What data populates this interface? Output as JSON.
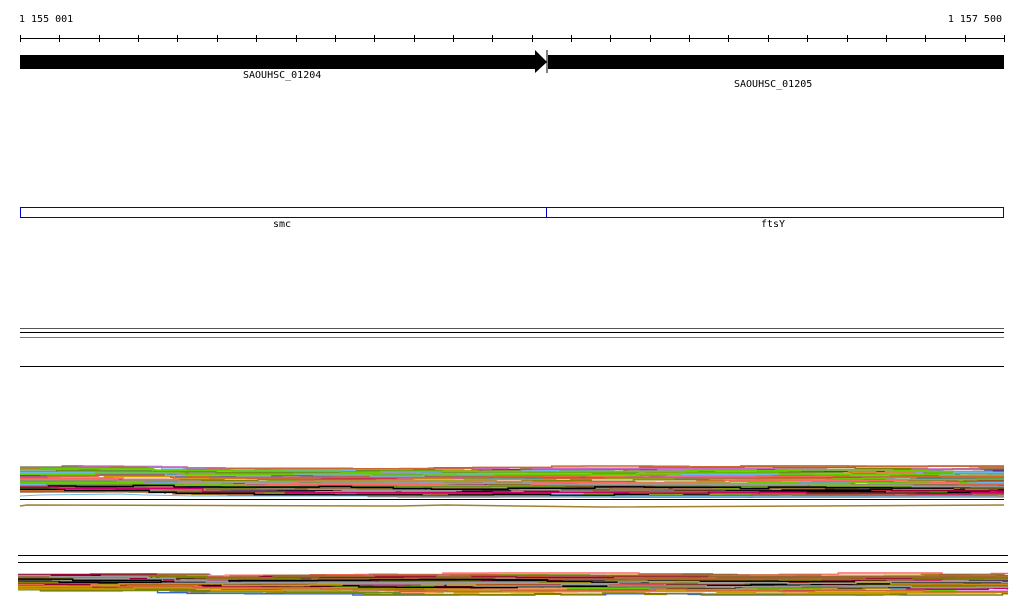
{
  "ruler": {
    "start_label": "1 155 001",
    "end_label": "1 157 500",
    "tick_count": 25
  },
  "genes": [
    {
      "name": "SAOUHSC_01204",
      "strand": "+"
    },
    {
      "name": "SAOUHSC_01205",
      "strand": "+"
    }
  ],
  "features": [
    {
      "name": "smc"
    },
    {
      "name": "ftsY"
    }
  ],
  "colors": {
    "feature_outline": "#0000cc",
    "green_line": "#00cc00",
    "track_palette": [
      "#808000",
      "#6b8e23",
      "#66cc00",
      "#cc6633",
      "#ff6666",
      "#6ab8e8",
      "#cc0066",
      "#990033",
      "#000000",
      "#999999",
      "#cc66cc",
      "#996633",
      "#3366cc",
      "#cc9900",
      "#ff9966"
    ]
  }
}
